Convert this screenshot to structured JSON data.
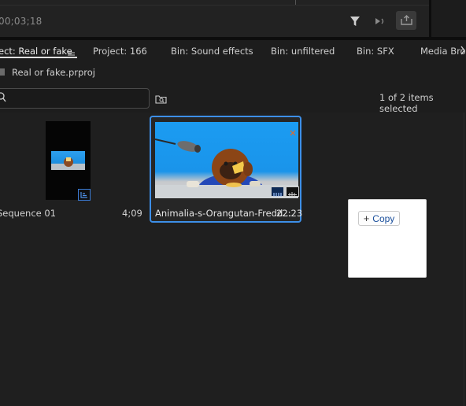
{
  "monitor": {
    "timecode": "00;03;18"
  },
  "tabs": [
    {
      "label": "ect: Real or fake"
    },
    {
      "label": "Project: 166"
    },
    {
      "label": "Bin: Sound effects"
    },
    {
      "label": "Bin: unfiltered"
    },
    {
      "label": "Bin: SFX"
    },
    {
      "label": "Media Bro"
    }
  ],
  "project": {
    "file_name": "Real or fake.prproj"
  },
  "search": {
    "value": "",
    "placeholder": ""
  },
  "status": {
    "items_selected": "1 of 2 items selected"
  },
  "items": [
    {
      "name": "Sequence 01",
      "duration": "4;09"
    },
    {
      "name": "Animalia-s-Orangutan-Fredd...",
      "duration": "22:23"
    }
  ],
  "popup": {
    "copy_label": "Copy"
  },
  "colors": {
    "accent": "#3d8fe8",
    "panel_bg": "#1d1d1d",
    "sky_blue": "#1b9cf2"
  },
  "icons": {
    "filter": "filter-icon",
    "playback": "playback-icon",
    "export": "export-icon",
    "tab_menu": "hamburger-menu-icon",
    "search": "search-icon",
    "new_search_bin": "new-search-bin-icon",
    "sequence": "sequence-icon",
    "video": "video-track-icon",
    "audio": "audio-track-icon",
    "plus": "plus-icon"
  }
}
